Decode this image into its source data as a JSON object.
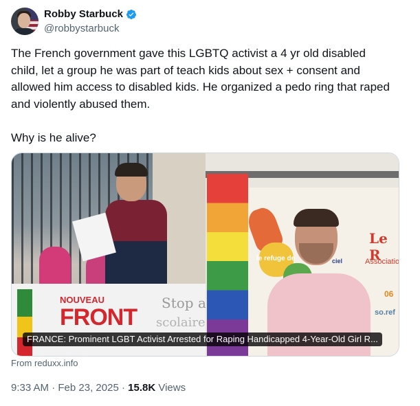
{
  "author": {
    "display_name": "Robby Starbuck",
    "handle": "@robbystarbuck",
    "verified_icon": "verified-badge-icon",
    "verified_color": "#1d9bf0"
  },
  "tweet": {
    "text": "The French government gave this LGBTQ activist a 4 yr old disabled child, let a group he was part of teach kids about sex + consent and allowed him access to disabled kids. He organized a pedo ring that raped and violently abused them.\n\nWhy is he alive?"
  },
  "link_card": {
    "title": "FRANCE: Prominent LGBT Activist Arrested for Raping Handicapped 4-Year-Old Girl R...",
    "source": "From reduxx.info",
    "image_text": {
      "nouveau": "NOUVEAU",
      "front": "FRONT",
      "stop": "Stop au",
      "scolaire": "scolaire a",
      "le": "Le R",
      "assoc": "Associatio",
      "num": "06",
      "so": "so.ref",
      "refuge": "le refuge de",
      "ciel": "ciel"
    }
  },
  "meta": {
    "time": "9:33 AM",
    "separator": "·",
    "date": "Feb 23, 2025",
    "views_count": "15.8K",
    "views_label": "Views"
  }
}
